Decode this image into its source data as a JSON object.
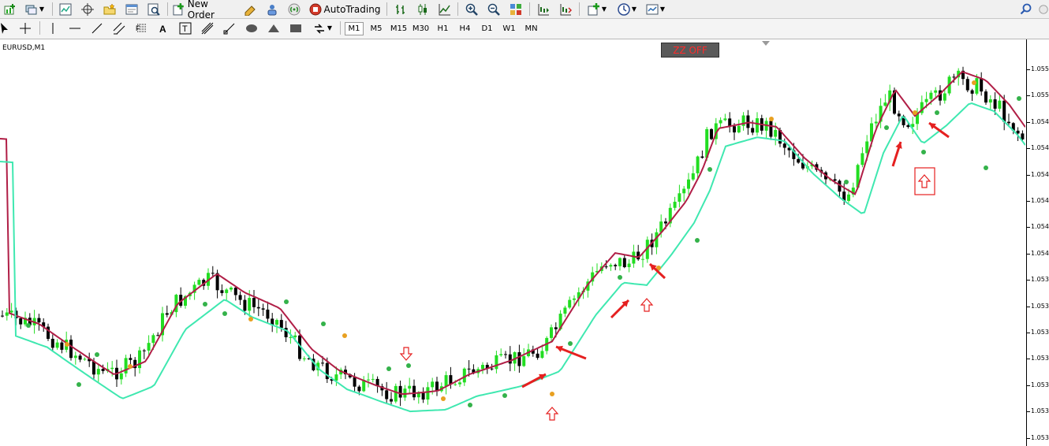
{
  "toolbar_top": {
    "new_order_label": "New Order",
    "autotrading_label": "AutoTrading"
  },
  "toolbar_timeframes": [
    "M1",
    "M5",
    "M15",
    "M30",
    "H1",
    "H4",
    "D1",
    "W1",
    "MN"
  ],
  "active_timeframe": "M1",
  "chart": {
    "symbol_label": "EURUSD,M1",
    "zz_button_label": "ZZ OFF",
    "price_labels": [
      "1.055",
      "1.055",
      "1.054",
      "1.054",
      "1.054",
      "1.054",
      "1.054",
      "1.054",
      "1.053",
      "1.053",
      "1.053",
      "1.053",
      "1.053",
      "1.053",
      "1.053"
    ]
  },
  "colors": {
    "bull_candle": "#22dd22",
    "bear_candle": "#000000",
    "ma_fast": "#3fe8b0",
    "ma_slow": "#b01e46",
    "signal_up": "#34b24a",
    "signal_down": "#e8a020",
    "annotation": "#e52020"
  }
}
